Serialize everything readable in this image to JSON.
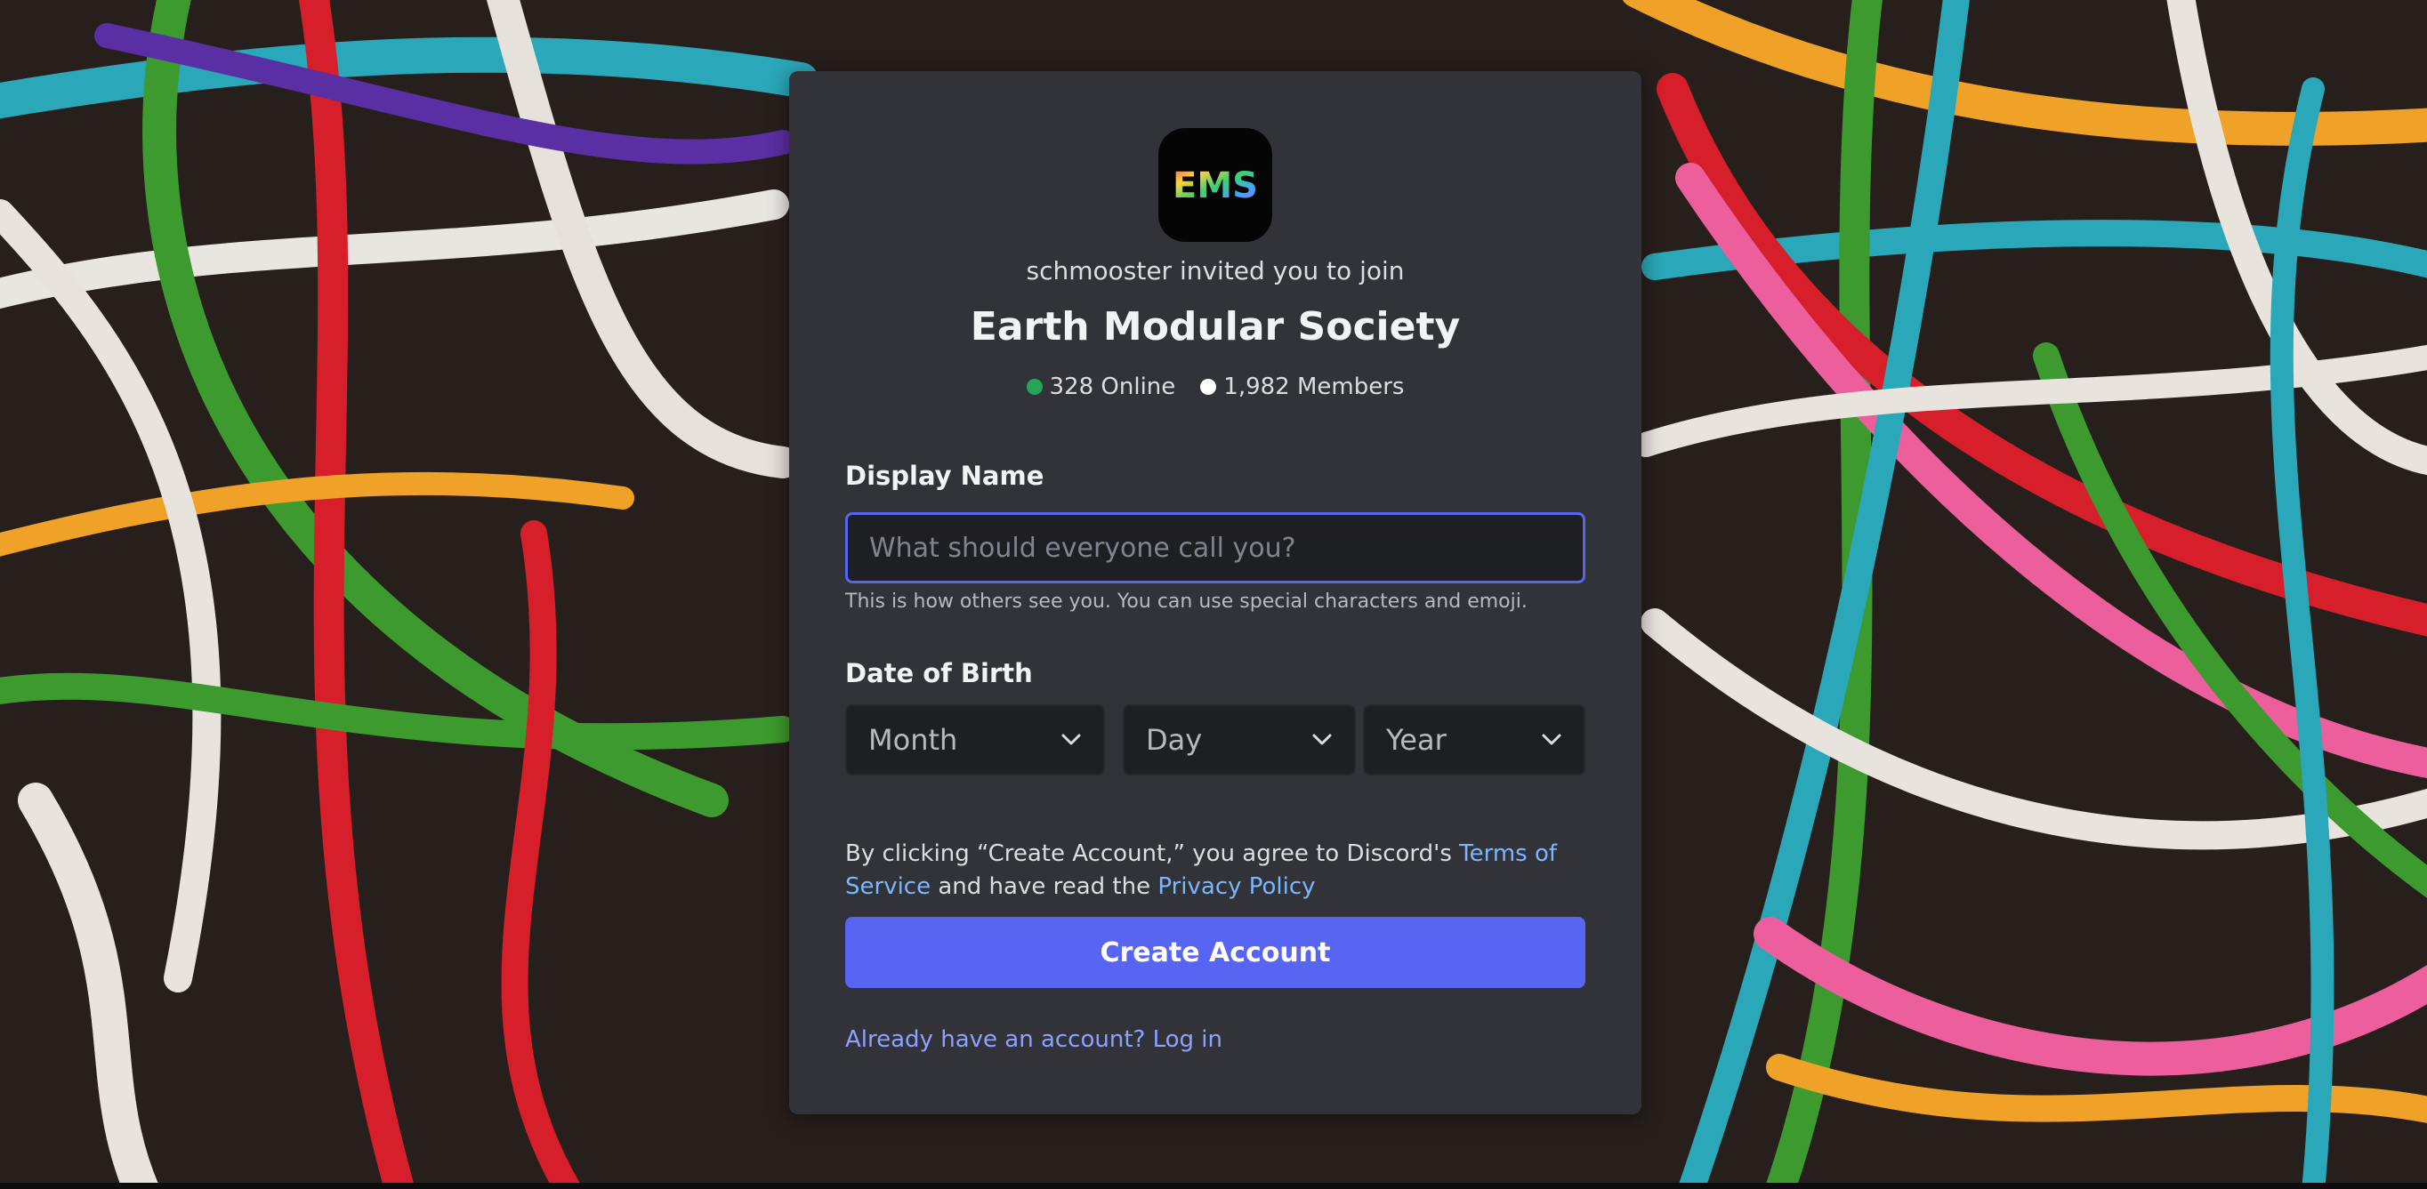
{
  "invite": {
    "icon_text": "EMS",
    "inviter_line": "schmooster invited you to join",
    "server_name": "Earth Modular Society",
    "online": "328 Online",
    "members": "1,982 Members"
  },
  "form": {
    "display_name_label": "Display Name",
    "display_name_placeholder": "What should everyone call you?",
    "display_name_value": "",
    "display_name_hint": "This is how others see you. You can use special characters and emoji.",
    "dob_label": "Date of Birth",
    "month_placeholder": "Month",
    "day_placeholder": "Day",
    "year_placeholder": "Year"
  },
  "legal": {
    "prefix": "By clicking “Create Account,” you agree to Discord's ",
    "terms_link": "Terms of Service",
    "middle": " and have read the ",
    "privacy_link": "Privacy Policy"
  },
  "actions": {
    "create_account": "Create Account",
    "login_link": "Already have an account? Log in"
  },
  "colors": {
    "accent": "#5865f2",
    "online_dot": "#23a55a",
    "members_dot": "#ffffff",
    "modal_bg": "#313338",
    "input_bg": "#1e1f22",
    "link": "#00a8fc"
  },
  "icons": {
    "dropdown": "chevron-down-icon",
    "online_status": "online-dot-icon",
    "members_status": "members-dot-icon"
  }
}
